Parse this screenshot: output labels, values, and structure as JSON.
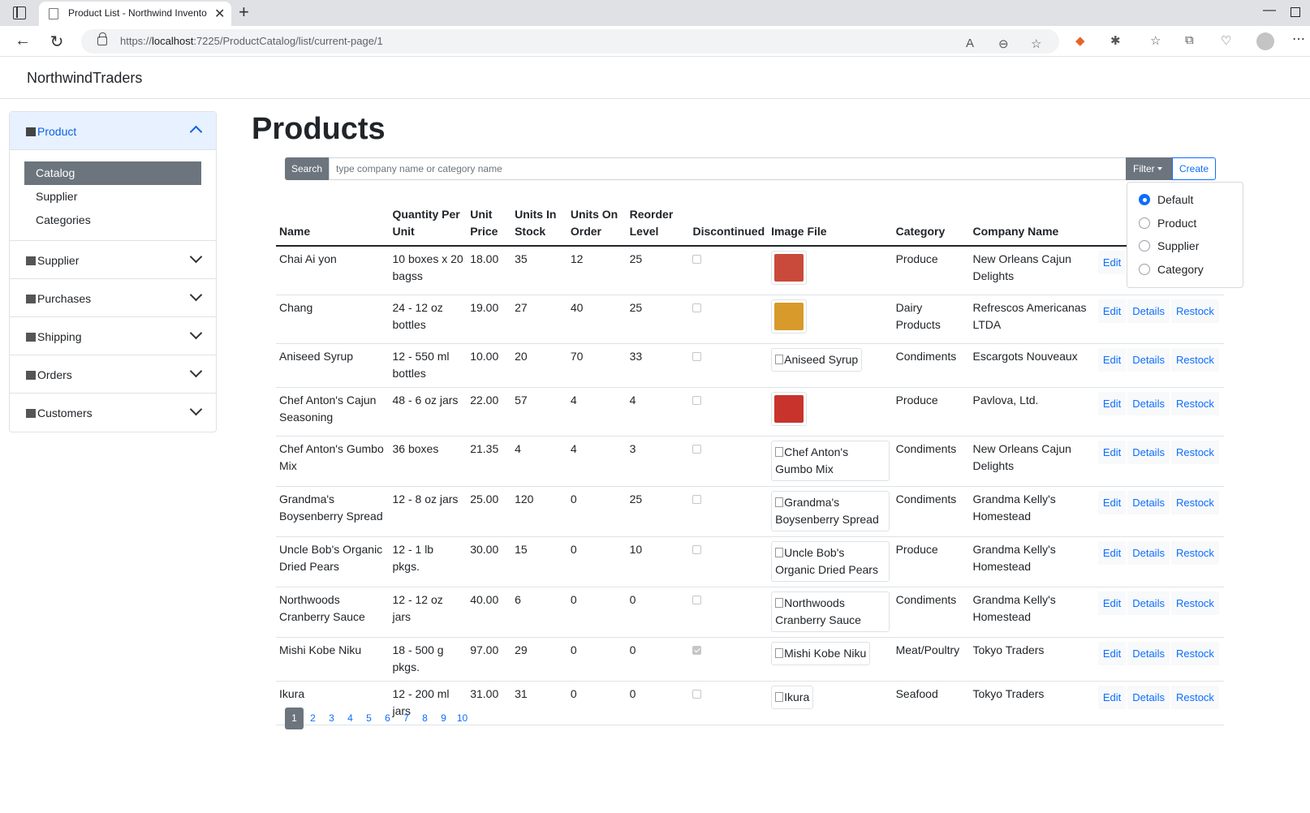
{
  "browser": {
    "tab_title": "Product List - Northwind Invento",
    "url_prefix": "https://",
    "url_host": "localhost",
    "url_path": ":7225/ProductCatalog/list/current-page/1"
  },
  "app": {
    "brand": "NorthwindTraders"
  },
  "sidebar": {
    "sections": [
      {
        "label": "Product",
        "expanded": true,
        "items": [
          "Catalog",
          "Supplier",
          "Categories"
        ],
        "active_item": "Catalog"
      },
      {
        "label": "Supplier",
        "expanded": false
      },
      {
        "label": "Purchases",
        "expanded": false
      },
      {
        "label": "Shipping",
        "expanded": false
      },
      {
        "label": "Orders",
        "expanded": false
      },
      {
        "label": "Customers",
        "expanded": false
      }
    ]
  },
  "page": {
    "title": "Products"
  },
  "toolbar": {
    "search_label": "Search",
    "search_placeholder": "type company name or category name",
    "filter_label": "Filter",
    "create_label": "Create"
  },
  "filter_menu": {
    "options": [
      "Default",
      "Product",
      "Supplier",
      "Category"
    ],
    "selected": "Default"
  },
  "table": {
    "headers": [
      "Name",
      "Quantity Per Unit",
      "Unit Price",
      "Units In Stock",
      "Units On Order",
      "Reorder Level",
      "Discontinued",
      "Image File",
      "Category",
      "Company Name"
    ],
    "action_labels": {
      "edit": "Edit",
      "details": "Details",
      "restock": "Restock"
    },
    "rows": [
      {
        "name": "Chai Ai yon",
        "qty": "10 boxes x 20 bagss",
        "price": "18.00",
        "stock": "35",
        "on_order": "12",
        "reorder": "25",
        "discontinued": false,
        "image_alt": "",
        "image_color": "#c94a3a",
        "category": "Produce",
        "company": "New Orleans Cajun Delights"
      },
      {
        "name": "Chang",
        "qty": "24 - 12 oz bottles",
        "price": "19.00",
        "stock": "27",
        "on_order": "40",
        "reorder": "25",
        "discontinued": false,
        "image_alt": "",
        "image_color": "#d89a2a",
        "category": "Dairy Products",
        "company": "Refrescos Americanas LTDA"
      },
      {
        "name": "Aniseed Syrup",
        "qty": "12 - 550 ml bottles",
        "price": "10.00",
        "stock": "20",
        "on_order": "70",
        "reorder": "33",
        "discontinued": false,
        "image_alt": "Aniseed Syrup",
        "category": "Condiments",
        "company": "Escargots Nouveaux"
      },
      {
        "name": "Chef Anton's Cajun Seasoning",
        "qty": "48 - 6 oz jars",
        "price": "22.00",
        "stock": "57",
        "on_order": "4",
        "reorder": "4",
        "discontinued": false,
        "image_alt": "",
        "image_color": "#c8342c",
        "category": "Produce",
        "company": "Pavlova, Ltd."
      },
      {
        "name": "Chef Anton's Gumbo Mix",
        "qty": "36 boxes",
        "price": "21.35",
        "stock": "4",
        "on_order": "4",
        "reorder": "3",
        "discontinued": false,
        "image_alt": "Chef Anton's Gumbo Mix",
        "category": "Condiments",
        "company": "New Orleans Cajun Delights"
      },
      {
        "name": "Grandma's Boysenberry Spread",
        "qty": "12 - 8 oz jars",
        "price": "25.00",
        "stock": "120",
        "on_order": "0",
        "reorder": "25",
        "discontinued": false,
        "image_alt": "Grandma's Boysenberry Spread",
        "category": "Condiments",
        "company": "Grandma Kelly's Homestead"
      },
      {
        "name": "Uncle Bob's Organic Dried Pears",
        "qty": "12 - 1 lb pkgs.",
        "price": "30.00",
        "stock": "15",
        "on_order": "0",
        "reorder": "10",
        "discontinued": false,
        "image_alt": "Uncle Bob's Organic Dried Pears",
        "category": "Produce",
        "company": "Grandma Kelly's Homestead"
      },
      {
        "name": "Northwoods Cranberry Sauce",
        "qty": "12 - 12 oz jars",
        "price": "40.00",
        "stock": "6",
        "on_order": "0",
        "reorder": "0",
        "discontinued": false,
        "image_alt": "Northwoods Cranberry Sauce",
        "category": "Condiments",
        "company": "Grandma Kelly's Homestead"
      },
      {
        "name": "Mishi Kobe Niku",
        "qty": "18 - 500 g pkgs.",
        "price": "97.00",
        "stock": "29",
        "on_order": "0",
        "reorder": "0",
        "discontinued": true,
        "image_alt": "Mishi Kobe Niku",
        "category": "Meat/Poultry",
        "company": "Tokyo Traders"
      },
      {
        "name": "Ikura",
        "qty": "12 - 200 ml jars",
        "price": "31.00",
        "stock": "31",
        "on_order": "0",
        "reorder": "0",
        "discontinued": false,
        "image_alt": "Ikura",
        "category": "Seafood",
        "company": "Tokyo Traders"
      }
    ]
  },
  "pagination": {
    "pages": [
      "1",
      "2",
      "3",
      "4",
      "5",
      "6",
      "7",
      "8",
      "9",
      "10"
    ],
    "current": "1"
  }
}
